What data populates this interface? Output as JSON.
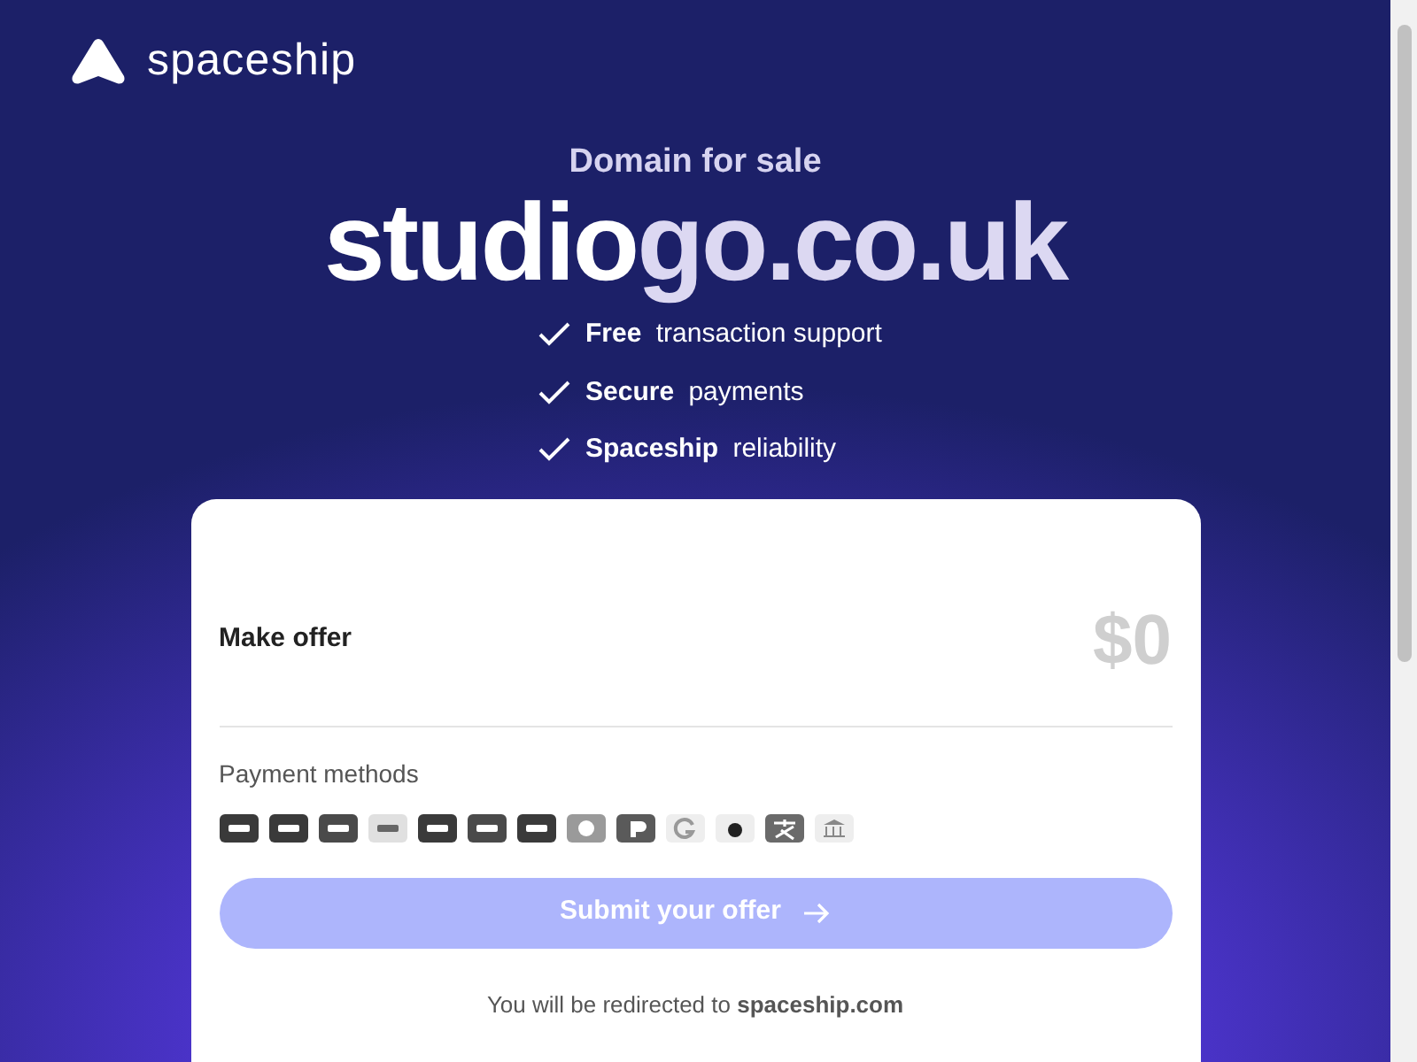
{
  "brand": {
    "name": "spaceship"
  },
  "hero": {
    "subtitle": "Domain for sale",
    "domain_main": "studio",
    "domain_rest": "go.co.uk"
  },
  "features": [
    {
      "text": "**Free** transaction support"
    },
    {
      "text": "**Secure** payments"
    },
    {
      "text": "**Spaceship** reliability"
    }
  ],
  "offer": {
    "label": "Make offer",
    "amount": "$0",
    "payment_label": "Payment methods",
    "submit": {
      "label": "Submit your offer",
      "disabled": true
    },
    "redirect_note": "You will be redirected to **spaceship.com**"
  }
}
